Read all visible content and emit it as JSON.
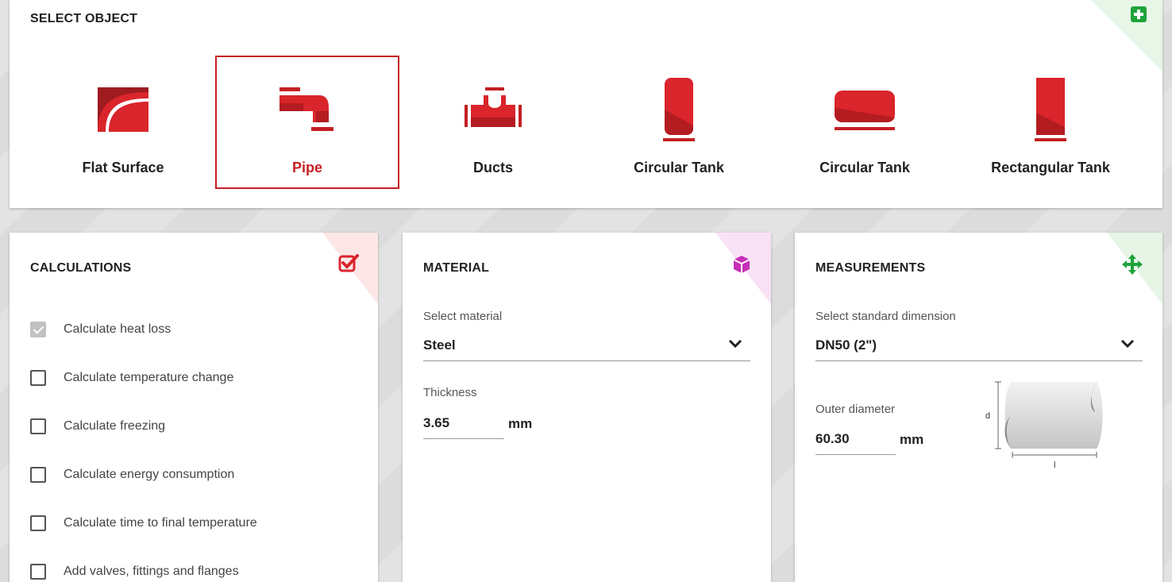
{
  "select_object": {
    "title": "SELECT OBJECT",
    "items": [
      {
        "label": "Flat Surface",
        "icon": "flat-surface-icon",
        "selected": false
      },
      {
        "label": "Pipe",
        "icon": "pipe-icon",
        "selected": true
      },
      {
        "label": "Ducts",
        "icon": "ducts-icon",
        "selected": false
      },
      {
        "label": "Circular Tank",
        "icon": "circular-tank-vertical-icon",
        "selected": false
      },
      {
        "label": "Circular Tank",
        "icon": "circular-tank-horizontal-icon",
        "selected": false
      },
      {
        "label": "Rectangular Tank",
        "icon": "rectangular-tank-icon",
        "selected": false
      }
    ]
  },
  "calculations": {
    "title": "CALCULATIONS",
    "options": [
      {
        "label": "Calculate heat loss",
        "checked": true
      },
      {
        "label": "Calculate temperature change",
        "checked": false
      },
      {
        "label": "Calculate freezing",
        "checked": false
      },
      {
        "label": "Calculate energy consumption",
        "checked": false
      },
      {
        "label": "Calculate time to final temperature",
        "checked": false
      },
      {
        "label": "Add valves, fittings and flanges",
        "checked": false
      }
    ]
  },
  "material": {
    "title": "MATERIAL",
    "select_label": "Select material",
    "selected_value": "Steel",
    "thickness_label": "Thickness",
    "thickness_value": "3.65",
    "thickness_unit": "mm"
  },
  "measurements": {
    "title": "MEASUREMENTS",
    "select_label": "Select standard dimension",
    "selected_value": "DN50 (2\")",
    "outer_diameter_label": "Outer diameter",
    "outer_diameter_value": "60.30",
    "outer_diameter_unit": "mm",
    "diagram_d_label": "d",
    "diagram_l_label": "l"
  },
  "colors": {
    "accent_red": "#c41f23",
    "add_green": "#1fa33a",
    "material_magenta": "#c62fb6",
    "measure_green": "#1fa33a"
  }
}
